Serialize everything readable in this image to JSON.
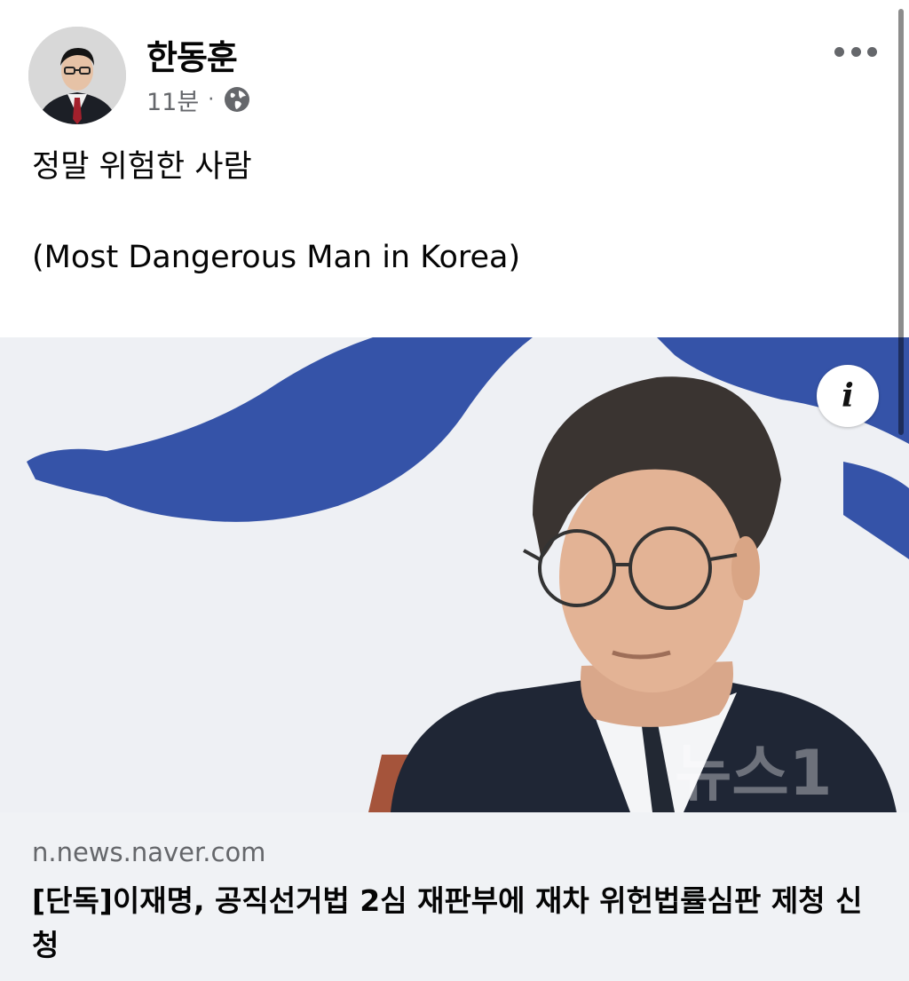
{
  "post": {
    "author_name": "한동훈",
    "time_ago": "11분",
    "separator": "·",
    "audience_icon": "globe-icon",
    "more_icon": "more-options-icon",
    "text_line1": "정말 위험한 사람",
    "text_line2": "(Most Dangerous Man in Korea)"
  },
  "link_preview": {
    "info_icon_label": "i",
    "image_watermark": "뉴스1",
    "domain": "n.news.naver.com",
    "title": "[단독]이재명, 공직선거법 2심 재판부에 재차 위헌법률심판 제청 신청"
  },
  "colors": {
    "accent_blue": "#3553a8",
    "secondary_text": "#65676b",
    "caption_bg": "#f0f2f5"
  }
}
